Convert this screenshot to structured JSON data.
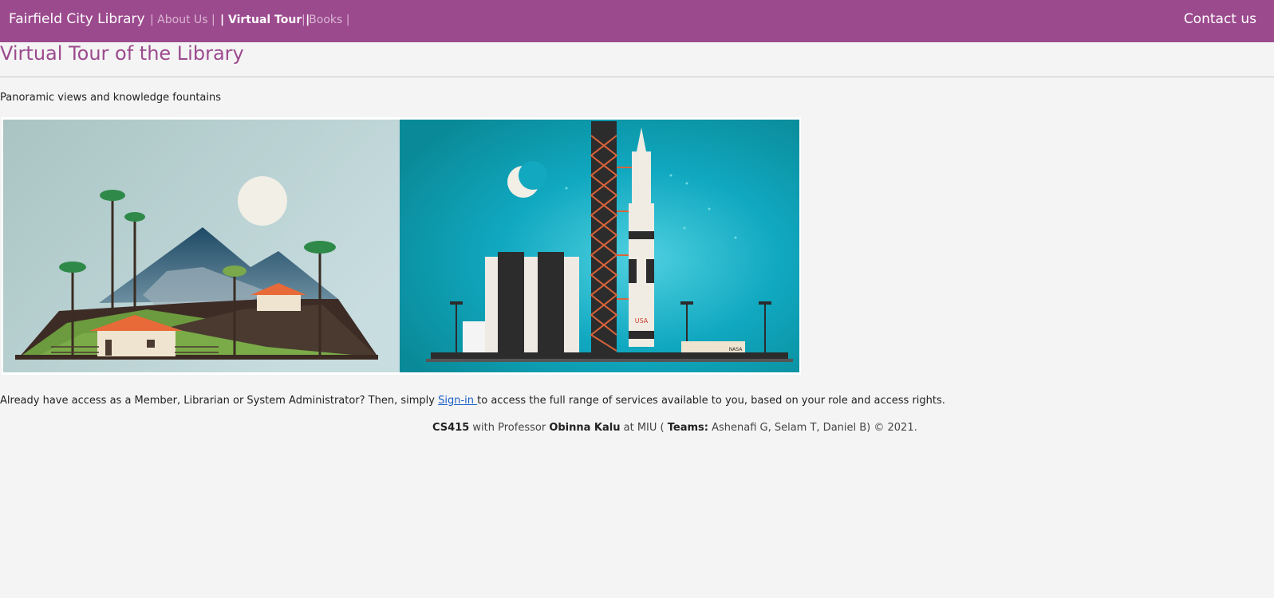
{
  "navbar": {
    "brand": "Fairfield City Library",
    "links": [
      {
        "label": "| About Us |"
      },
      {
        "label": "| Virtual Tour |"
      },
      {
        "label": "| Books |"
      }
    ],
    "contact": "Contact us"
  },
  "main": {
    "title": "Virtual Tour of the Library",
    "subtitle": "Panoramic views and knowledge fountains",
    "access_before": "Already have access as a Member, Librarian or System Administrator? Then, simply ",
    "signin_label": "Sign-in ",
    "access_after": "to access the full range of services available to you, based on your role and access rights."
  },
  "footer": {
    "course": "CS415",
    "with_prof": " with Professor ",
    "professor": "Obinna Kalu",
    "at": " at MIU ( ",
    "teams_label": "Teams:",
    "teams": " Ashenafi G, Selam T, Daniel B) © 2021."
  },
  "image": {
    "rocket_text": "USA",
    "building_text": "NASA"
  },
  "colors": {
    "brand": "#9c4a8e",
    "link": "#1a5fc7",
    "background": "#f4f4f4"
  }
}
